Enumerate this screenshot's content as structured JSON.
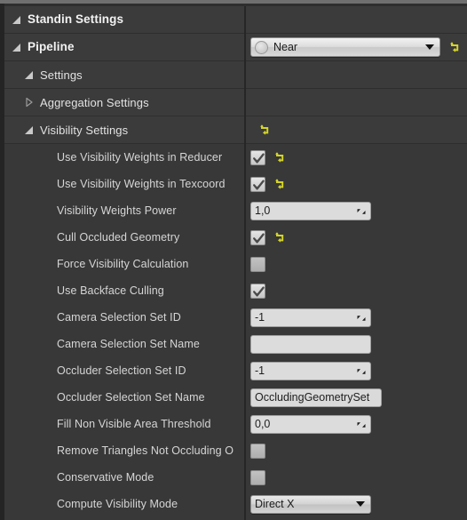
{
  "panel": {
    "title": "Standin Settings",
    "rows": [
      {
        "kind": "category",
        "label": "Standin Settings",
        "expander": "expanded",
        "indent": 0,
        "name": "category-standin-settings"
      },
      {
        "kind": "category",
        "label": "Pipeline",
        "expander": "expanded",
        "indent": 0,
        "name": "category-pipeline",
        "widget": "combo-icon",
        "value": "Near",
        "reset": true
      },
      {
        "kind": "category",
        "label": "Settings",
        "expander": "expanded",
        "indent": 1,
        "name": "category-settings"
      },
      {
        "kind": "category",
        "label": "Aggregation Settings",
        "expander": "collapsed",
        "indent": 1,
        "name": "category-aggregation-settings"
      },
      {
        "kind": "category",
        "label": "Visibility Settings",
        "expander": "expanded",
        "indent": 1,
        "name": "category-visibility-settings",
        "widget": "none",
        "reset": true
      },
      {
        "kind": "property",
        "label": "Use Visibility Weights in Reducer",
        "indent": 3,
        "name": "prop-use-visibility-weights-in-reducer",
        "widget": "checkbox",
        "checked": true,
        "reset": true
      },
      {
        "kind": "property",
        "label": "Use Visibility Weights in Texcoord",
        "indent": 3,
        "name": "prop-use-visibility-weights-in-texcoord",
        "widget": "checkbox",
        "checked": true,
        "reset": true
      },
      {
        "kind": "property",
        "label": "Visibility Weights Power",
        "indent": 3,
        "name": "prop-visibility-weights-power",
        "widget": "number",
        "value": "1,0",
        "reset": false
      },
      {
        "kind": "property",
        "label": "Cull Occluded Geometry",
        "indent": 3,
        "name": "prop-cull-occluded-geometry",
        "widget": "checkbox",
        "checked": true,
        "reset": true
      },
      {
        "kind": "property",
        "label": "Force Visibility Calculation",
        "indent": 3,
        "name": "prop-force-visibility-calculation",
        "widget": "checkbox",
        "checked": false,
        "reset": false
      },
      {
        "kind": "property",
        "label": "Use Backface Culling",
        "indent": 3,
        "name": "prop-use-backface-culling",
        "widget": "checkbox",
        "checked": true,
        "reset": false
      },
      {
        "kind": "property",
        "label": "Camera Selection Set ID",
        "indent": 3,
        "name": "prop-camera-selection-set-id",
        "widget": "number",
        "value": "-1",
        "reset": false
      },
      {
        "kind": "property",
        "label": "Camera Selection Set Name",
        "indent": 3,
        "name": "prop-camera-selection-set-name",
        "widget": "text",
        "value": "",
        "reset": false
      },
      {
        "kind": "property",
        "label": "Occluder Selection Set ID",
        "indent": 3,
        "name": "prop-occluder-selection-set-id",
        "widget": "number",
        "value": "-1",
        "reset": false
      },
      {
        "kind": "property",
        "label": "Occluder Selection Set Name",
        "indent": 3,
        "name": "prop-occluder-selection-set-name",
        "widget": "text-narrow",
        "value": "OccludingGeometrySet",
        "reset": false
      },
      {
        "kind": "property",
        "label": "Fill Non Visible Area Threshold",
        "indent": 3,
        "name": "prop-fill-non-visible-area-threshold",
        "widget": "number",
        "value": "0,0",
        "reset": false
      },
      {
        "kind": "property",
        "label": "Remove Triangles Not Occluding O",
        "indent": 3,
        "name": "prop-remove-triangles-not-occluding",
        "widget": "checkbox",
        "checked": false,
        "reset": false
      },
      {
        "kind": "property",
        "label": "Conservative Mode",
        "indent": 3,
        "name": "prop-conservative-mode",
        "widget": "checkbox",
        "checked": false,
        "reset": false
      },
      {
        "kind": "property",
        "label": "Compute Visibility Mode",
        "indent": 3,
        "name": "prop-compute-visibility-mode",
        "widget": "combo",
        "value": "Direct X",
        "reset": false
      }
    ]
  },
  "colors": {
    "panel_background": "#383838",
    "category_background": "#3b3b3b",
    "row_separator": "#2e2e2e",
    "label_text": "#d6d6d6",
    "reset_arrow": "#d4d42a",
    "widget_face": "#dcdcdc",
    "splitter": "#262626"
  },
  "icons": {
    "expander_expanded": "triangle-down-left",
    "expander_collapsed": "triangle-right-outline",
    "reset": "reset-arrow-icon",
    "dropdown": "chevron-down-icon",
    "spinner": "drag-spinner-icon",
    "check": "checkmark-icon",
    "combo_badge": "circle-icon"
  }
}
